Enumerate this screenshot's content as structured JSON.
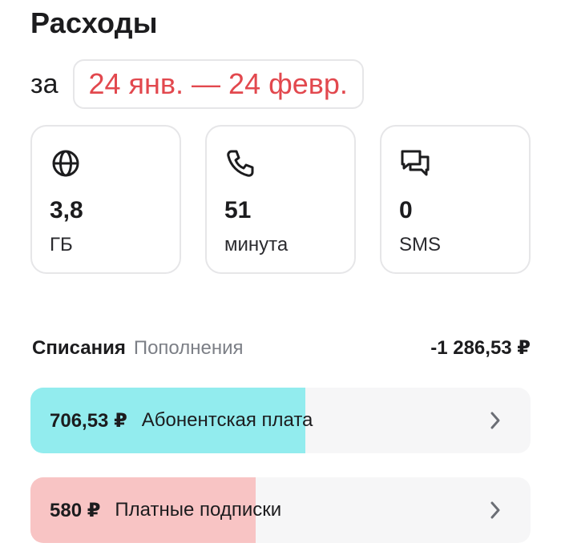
{
  "header": {
    "title": "Расходы",
    "period_prefix": "за",
    "period_value": "24 янв. — 24 февр."
  },
  "usage_cards": [
    {
      "icon": "globe-icon",
      "value": "3,8",
      "unit": "ГБ"
    },
    {
      "icon": "phone-icon",
      "value": "51",
      "unit": "минута"
    },
    {
      "icon": "chat-icon",
      "value": "0",
      "unit": "SMS"
    }
  ],
  "tabs": {
    "active": "Списания",
    "inactive": "Пополнения"
  },
  "total": "-1 286,53 ₽",
  "expenses": [
    {
      "amount": "706,53 ₽",
      "label": "Абонентская плата",
      "share": 0.549,
      "fill_color": "#92ecee",
      "icon": "chevron-right-icon"
    },
    {
      "amount": "580 ₽",
      "label": "Платные подписки",
      "share": 0.451,
      "fill_color": "#f8c4c4",
      "icon": "chevron-right-icon"
    }
  ],
  "colors": {
    "accent_red": "#e2484e",
    "muted_text": "#7c7f86",
    "card_border": "#e6e6e8",
    "row_background": "#f6f6f7"
  }
}
